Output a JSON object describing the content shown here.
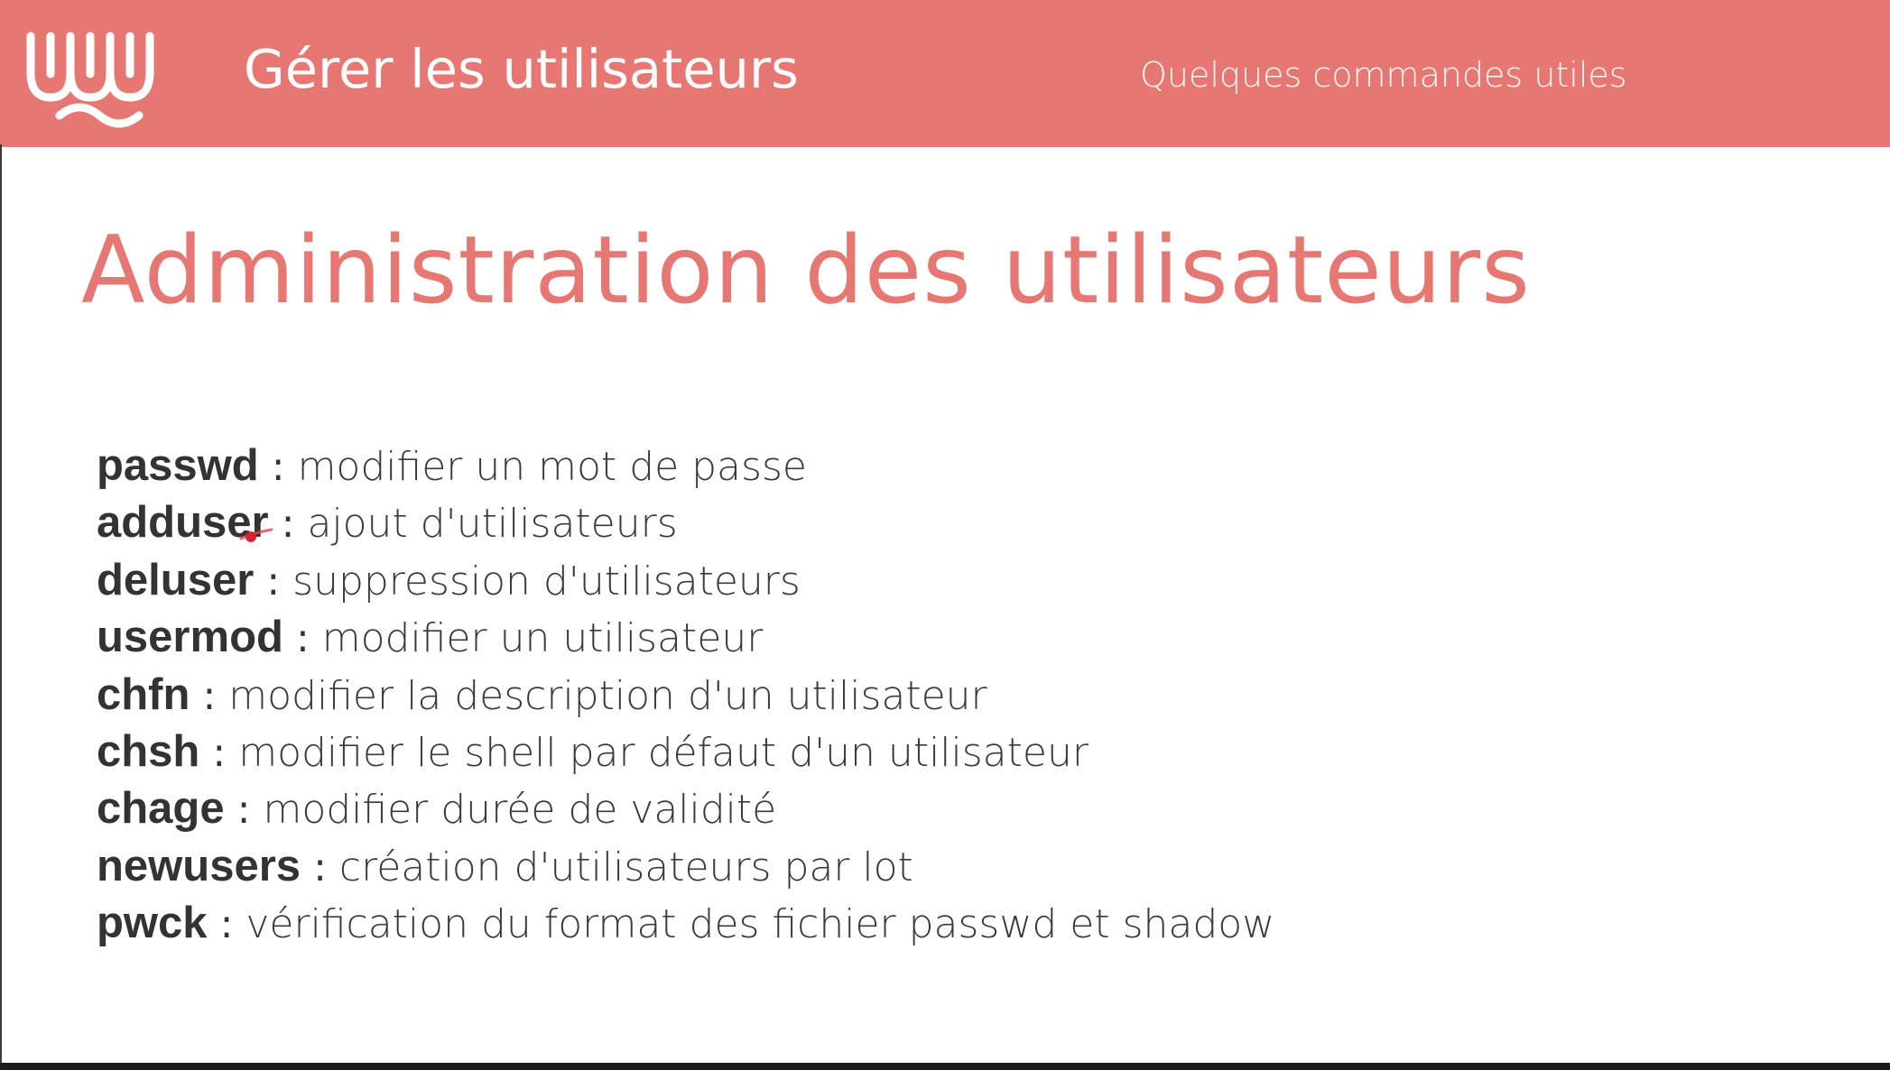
{
  "header": {
    "title": "Gérer les utilisateurs",
    "subtitle": "Quelques commandes utiles",
    "logo_icon": "wave-logo-icon",
    "background_color": "#e77772",
    "text_color": "#ffffff"
  },
  "main": {
    "title": "Administration des utilisateurs",
    "title_color": "#e77772",
    "separator": ":",
    "commands": [
      {
        "name": "passwd",
        "description": "modifier un mot de passe"
      },
      {
        "name": "adduser",
        "description": "ajout d'utilisateurs"
      },
      {
        "name": "deluser",
        "description": "suppression d'utilisateurs"
      },
      {
        "name": "usermod",
        "description": "modifier un utilisateur"
      },
      {
        "name": "chfn",
        "description": "modifier la description d'un utilisateur"
      },
      {
        "name": "chsh",
        "description": "modifier le shell par défaut d'un utilisateur"
      },
      {
        "name": "chage",
        "description": "modifier durée de validité"
      },
      {
        "name": "newusers",
        "description": "création d'utilisateurs par lot"
      },
      {
        "name": "pwck",
        "description": "vérification du format des fichier passwd et shadow"
      }
    ]
  }
}
